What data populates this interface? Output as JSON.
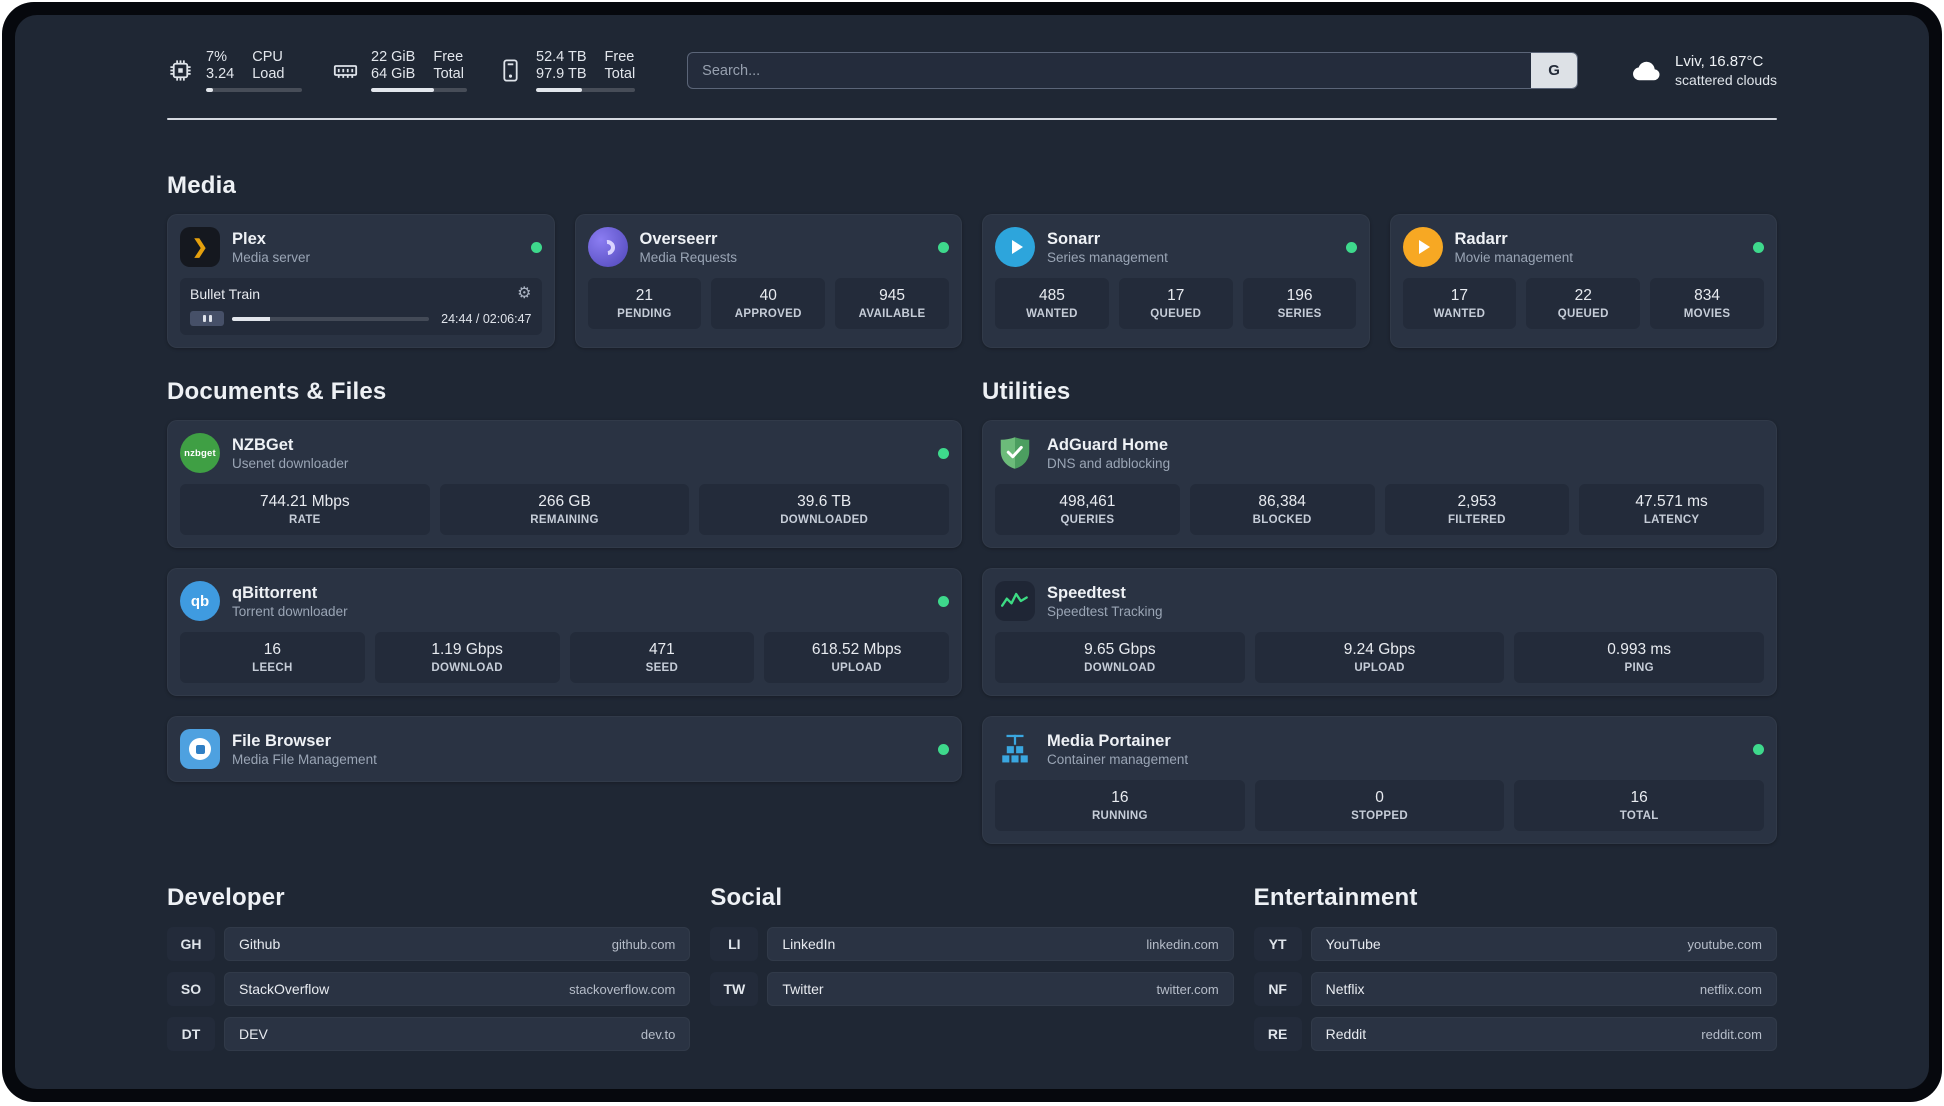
{
  "colors": {
    "background": "#1f2734",
    "card": "#2a3343",
    "stat_box": "#232b3a",
    "status_online": "#3ed98c",
    "plex_amber": "#e5a00d",
    "overseerr_purple": "#5f55c9",
    "sonarr_blue": "#2da5dc",
    "radarr_yellow": "#f7a823",
    "nzbget_green": "#3f9f44",
    "qbittorrent_blue": "#3f9be0",
    "filebrowser_blue": "#4ea1e0",
    "adguard_green": "#5cab6c",
    "speedtest_green": "#3ddc84",
    "portainer_blue": "#3aa7e0"
  },
  "topbar": {
    "cpu": {
      "percent": "7%",
      "load": "3.24",
      "label_top": "CPU",
      "label_bottom": "Load",
      "bar_pct": 7
    },
    "memory": {
      "free": "22 GiB",
      "total": "64 GiB",
      "label_top": "Free",
      "label_bottom": "Total",
      "bar_pct": 66
    },
    "disk": {
      "free": "52.4 TB",
      "total": "97.9 TB",
      "label_top": "Free",
      "label_bottom": "Total",
      "bar_pct": 46
    },
    "search": {
      "placeholder": "Search...",
      "button_label": "G"
    },
    "weather": {
      "location": "Lviv, 16.87°C",
      "condition": "scattered clouds"
    }
  },
  "media": {
    "heading": "Media",
    "cards": [
      {
        "title": "Plex",
        "subtitle": "Media server",
        "online": true,
        "icon_glyph": "❯",
        "gear_glyph": "⚙",
        "player": {
          "track": "Bullet Train",
          "time": "24:44 / 02:06:47",
          "progress_pct": 19.5
        }
      },
      {
        "title": "Overseerr",
        "subtitle": "Media Requests",
        "online": true,
        "stats": [
          {
            "value": "21",
            "label": "PENDING"
          },
          {
            "value": "40",
            "label": "APPROVED"
          },
          {
            "value": "945",
            "label": "AVAILABLE"
          }
        ]
      },
      {
        "title": "Sonarr",
        "subtitle": "Series management",
        "online": true,
        "stats": [
          {
            "value": "485",
            "label": "WANTED"
          },
          {
            "value": "17",
            "label": "QUEUED"
          },
          {
            "value": "196",
            "label": "SERIES"
          }
        ]
      },
      {
        "title": "Radarr",
        "subtitle": "Movie management",
        "online": true,
        "stats": [
          {
            "value": "17",
            "label": "WANTED"
          },
          {
            "value": "22",
            "label": "QUEUED"
          },
          {
            "value": "834",
            "label": "MOVIES"
          }
        ]
      }
    ]
  },
  "documents": {
    "heading": "Documents & Files",
    "cards": [
      {
        "title": "NZBGet",
        "subtitle": "Usenet downloader",
        "online": true,
        "icon_text": "nzbget",
        "stats": [
          {
            "value": "744.21 Mbps",
            "label": "RATE"
          },
          {
            "value": "266 GB",
            "label": "REMAINING"
          },
          {
            "value": "39.6 TB",
            "label": "DOWNLOADED"
          }
        ]
      },
      {
        "title": "qBittorrent",
        "subtitle": "Torrent downloader",
        "online": true,
        "icon_text": "qb",
        "stats": [
          {
            "value": "16",
            "label": "LEECH"
          },
          {
            "value": "1.19 Gbps",
            "label": "DOWNLOAD"
          },
          {
            "value": "471",
            "label": "SEED"
          },
          {
            "value": "618.52 Mbps",
            "label": "UPLOAD"
          }
        ]
      },
      {
        "title": "File Browser",
        "subtitle": "Media File Management",
        "online": true
      }
    ]
  },
  "utilities": {
    "heading": "Utilities",
    "cards": [
      {
        "title": "AdGuard Home",
        "subtitle": "DNS and adblocking",
        "stats": [
          {
            "value": "498,461",
            "label": "QUERIES"
          },
          {
            "value": "86,384",
            "label": "BLOCKED"
          },
          {
            "value": "2,953",
            "label": "FILTERED"
          },
          {
            "value": "47.571 ms",
            "label": "LATENCY"
          }
        ]
      },
      {
        "title": "Speedtest",
        "subtitle": "Speedtest Tracking",
        "stats": [
          {
            "value": "9.65 Gbps",
            "label": "DOWNLOAD"
          },
          {
            "value": "9.24 Gbps",
            "label": "UPLOAD"
          },
          {
            "value": "0.993 ms",
            "label": "PING"
          }
        ]
      },
      {
        "title": "Media Portainer",
        "subtitle": "Container management",
        "online": true,
        "stats": [
          {
            "value": "16",
            "label": "RUNNING"
          },
          {
            "value": "0",
            "label": "STOPPED"
          },
          {
            "value": "16",
            "label": "TOTAL"
          }
        ]
      }
    ]
  },
  "bookmarks": {
    "groups": [
      {
        "heading": "Developer",
        "items": [
          {
            "abbr": "GH",
            "name": "Github",
            "url": "github.com"
          },
          {
            "abbr": "SO",
            "name": "StackOverflow",
            "url": "stackoverflow.com"
          },
          {
            "abbr": "DT",
            "name": "DEV",
            "url": "dev.to"
          }
        ]
      },
      {
        "heading": "Social",
        "items": [
          {
            "abbr": "LI",
            "name": "LinkedIn",
            "url": "linkedin.com"
          },
          {
            "abbr": "TW",
            "name": "Twitter",
            "url": "twitter.com"
          }
        ]
      },
      {
        "heading": "Entertainment",
        "items": [
          {
            "abbr": "YT",
            "name": "YouTube",
            "url": "youtube.com"
          },
          {
            "abbr": "NF",
            "name": "Netflix",
            "url": "netflix.com"
          },
          {
            "abbr": "RE",
            "name": "Reddit",
            "url": "reddit.com"
          }
        ]
      }
    ]
  }
}
